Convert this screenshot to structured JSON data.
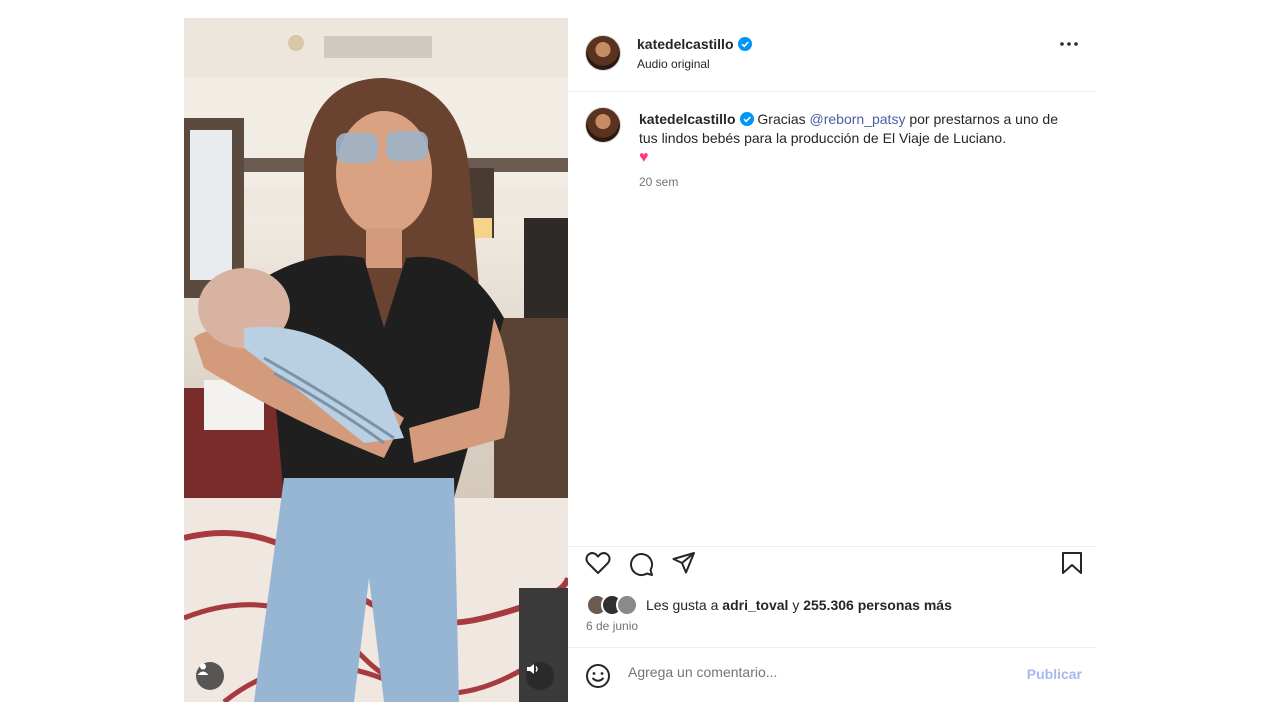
{
  "post": {
    "author": "katedelcastillo",
    "audio": "Audio original",
    "caption": {
      "username": "katedelcastillo",
      "text_before": "Gracias",
      "mention": "@reborn_patsy",
      "text_after": "por prestarnos a uno de tus lindos bebés para la producción de El Viaje de Luciano.",
      "emoji": "♥"
    },
    "time_ago": "20 sem",
    "likes": {
      "prefix": "Les gusta a",
      "user": "adri_toval",
      "and": "y",
      "count_text": "255.306 personas más"
    },
    "date": "6 de junio"
  },
  "comment": {
    "placeholder": "Agrega un comentario...",
    "publish_label": "Publicar"
  },
  "icons": {
    "verified": "verified-badge-icon",
    "more": "more-options-icon",
    "like": "heart-icon",
    "comment": "comment-icon",
    "share": "send-icon",
    "save": "bookmark-icon",
    "emoji": "smiley-icon",
    "user_tag": "user-tag-icon",
    "audio": "speaker-icon"
  },
  "colors": {
    "verified": "#0095f6",
    "mention": "#4a5da8",
    "publish": "#a8b7f0",
    "heart_emoji": "#ff3b7a"
  }
}
